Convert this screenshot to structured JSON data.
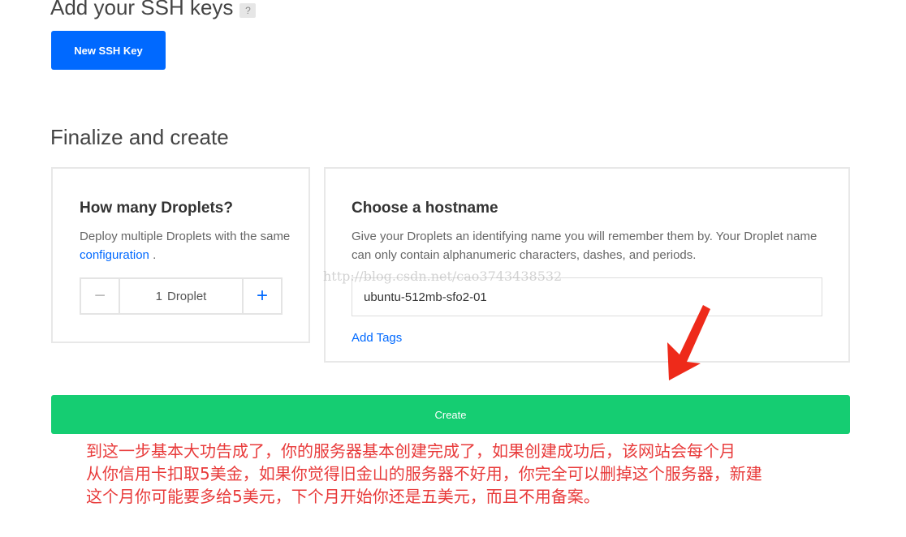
{
  "ssh": {
    "title": "Add your SSH keys",
    "help_badge": "?",
    "new_button": "New SSH Key"
  },
  "finalize": {
    "title": "Finalize and create"
  },
  "droplets": {
    "heading": "How many Droplets?",
    "desc_before": "Deploy multiple Droplets with the same",
    "desc_link": "configuration",
    "desc_after": ".",
    "minus": "−",
    "plus": "+",
    "count": "1",
    "unit": "Droplet"
  },
  "hostname": {
    "heading": "Choose a hostname",
    "desc": "Give your Droplets an identifying name you will remember them by. Your Droplet name can only contain alphanumeric characters, dashes, and periods.",
    "value": "ubuntu-512mb-sfo2-01",
    "add_tags": "Add Tags"
  },
  "watermark": "http://blog.csdn.net/cao3743438532",
  "create_button": "Create",
  "note": {
    "lines": [
      "到这一步基本大功告成了，你的服务器基本创建完成了，如果创建成功后，该网站会每个月",
      "从你信用卡扣取5美金，如果你觉得旧金山的服务器不好用，你完全可以删掉这个服务器，新建",
      "这个月你可能要多给5美元，下个月开始你还是五美元，而且不用备案。"
    ],
    "color": "#e83a3a"
  },
  "colors": {
    "primary": "#0069ff",
    "success": "#15cd72",
    "arrow": "#ee2a1a"
  },
  "icons": {
    "arrow": "red-arrow-pointing-down-left"
  }
}
